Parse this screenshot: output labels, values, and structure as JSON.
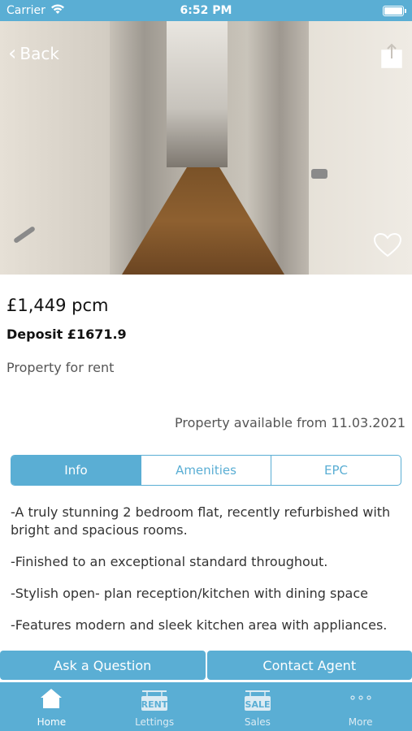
{
  "status_bar": {
    "carrier": "Carrier",
    "time": "6:52 PM"
  },
  "header": {
    "back_label": "Back"
  },
  "listing": {
    "price": "£1,449 pcm",
    "deposit": "Deposit £1671.9",
    "property_type": "Property for rent",
    "available": "Property available from 11.03.2021"
  },
  "tabs": [
    {
      "label": "Info",
      "active": true
    },
    {
      "label": "Amenities",
      "active": false
    },
    {
      "label": "EPC",
      "active": false
    }
  ],
  "info_lines": [
    "-A truly stunning 2 bedroom flat, recently refurbished with bright and spacious rooms.",
    "-Finished to an exceptional standard throughout.",
    "-Stylish open- plan reception/kitchen with dining space",
    "-Features modern and sleek kitchen area with appliances."
  ],
  "actions": {
    "ask": "Ask a Question",
    "contact": "Contact Agent"
  },
  "tabbar": [
    {
      "label": "Home",
      "icon": "home-icon",
      "active": true
    },
    {
      "label": "Lettings",
      "icon": "rent-sign-icon",
      "badge": "RENT",
      "active": false
    },
    {
      "label": "Sales",
      "icon": "sale-sign-icon",
      "badge": "SALE",
      "active": false
    },
    {
      "label": "More",
      "icon": "more-dots-icon",
      "active": false
    }
  ],
  "colors": {
    "accent": "#5aaed4"
  }
}
